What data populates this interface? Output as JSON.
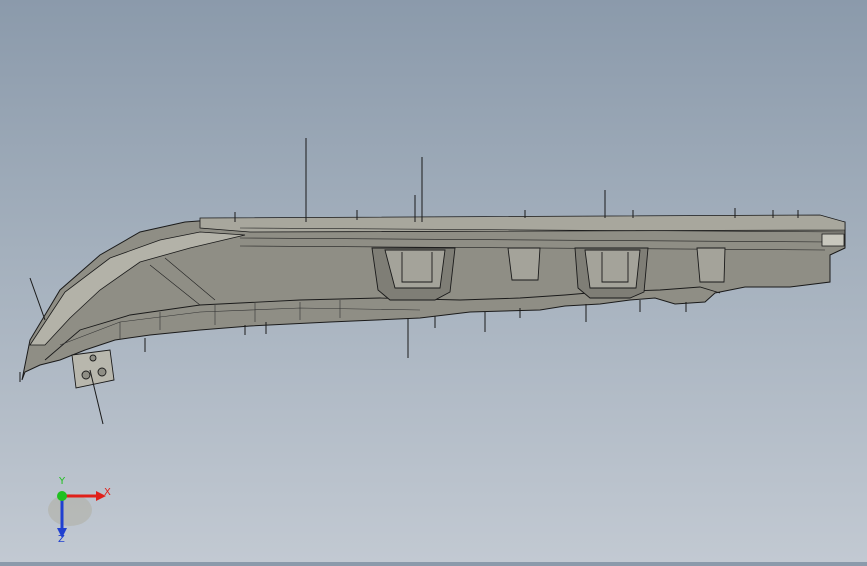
{
  "viewport": {
    "background_top": "#8b9aab",
    "background_bottom": "#c2c9d2",
    "model_fill": "#8f8e85",
    "model_fill_light": "#a8a79d",
    "model_fill_dark": "#6d6c64",
    "edge_color": "#1a1a1a"
  },
  "triad": {
    "x_label": "X",
    "y_label": "Y",
    "z_label": "Z",
    "x_color": "#e0201a",
    "y_color": "#20c020",
    "z_color": "#2040d0"
  }
}
